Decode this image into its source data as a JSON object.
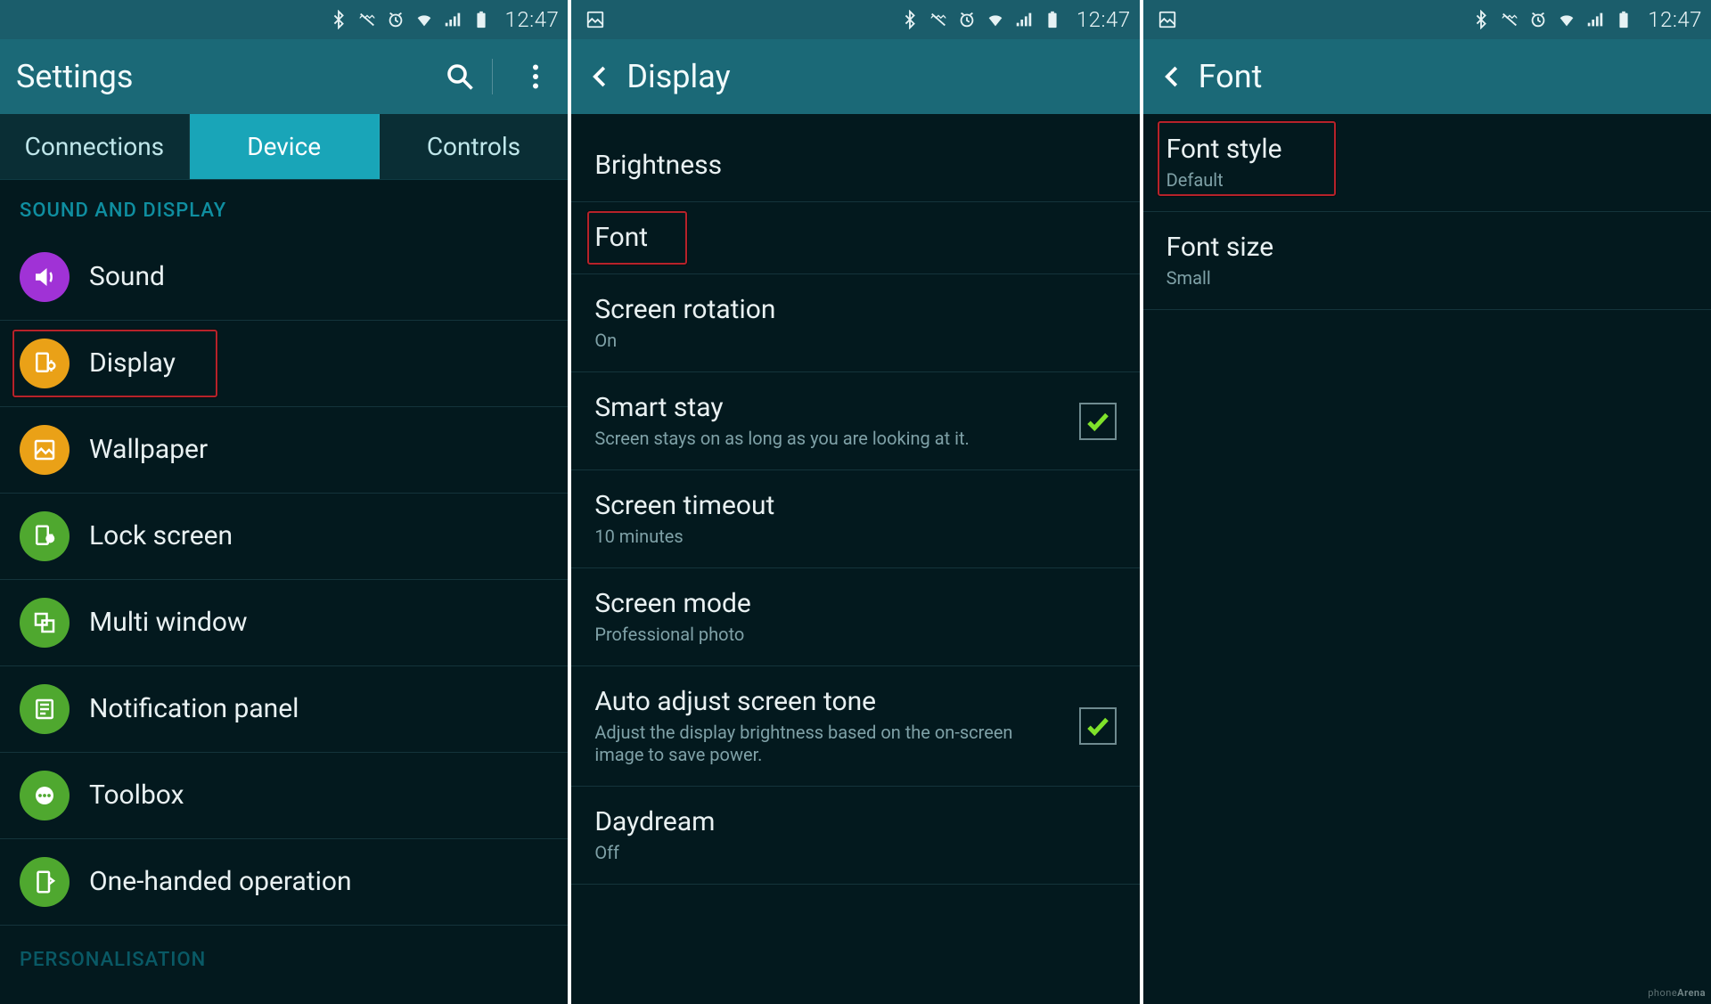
{
  "statusbar": {
    "time": "12:47"
  },
  "screen1": {
    "title": "Settings",
    "tabs": {
      "connections": "Connections",
      "device": "Device",
      "controls": "Controls"
    },
    "section1_header": "SOUND AND DISPLAY",
    "items": {
      "sound": "Sound",
      "display": "Display",
      "wallpaper": "Wallpaper",
      "lock_screen": "Lock screen",
      "multi_window": "Multi window",
      "notification_panel": "Notification panel",
      "toolbox": "Toolbox",
      "one_handed": "One-handed operation"
    },
    "section2_header": "PERSONALISATION"
  },
  "screen2": {
    "title": "Display",
    "items": {
      "brightness": {
        "label": "Brightness"
      },
      "font": {
        "label": "Font"
      },
      "screen_rotation": {
        "label": "Screen rotation",
        "sub": "On"
      },
      "smart_stay": {
        "label": "Smart stay",
        "sub": "Screen stays on as long as you are looking at it.",
        "checked": true
      },
      "screen_timeout": {
        "label": "Screen timeout",
        "sub": "10 minutes"
      },
      "screen_mode": {
        "label": "Screen mode",
        "sub": "Professional photo"
      },
      "auto_adjust": {
        "label": "Auto adjust screen tone",
        "sub": "Adjust the display brightness based on the on-screen image to save power.",
        "checked": true
      },
      "daydream": {
        "label": "Daydream",
        "sub": "Off"
      }
    }
  },
  "screen3": {
    "title": "Font",
    "items": {
      "font_style": {
        "label": "Font style",
        "sub": "Default"
      },
      "font_size": {
        "label": "Font size",
        "sub": "Small"
      }
    }
  },
  "watermark": {
    "a": "phone",
    "b": "Arena"
  }
}
